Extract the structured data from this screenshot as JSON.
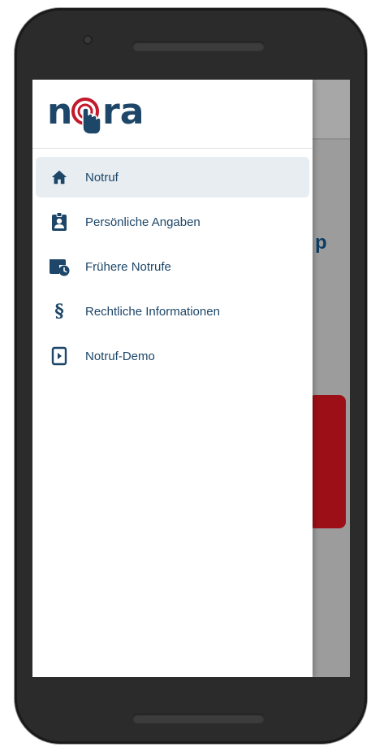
{
  "app": {
    "logo_text": "nora",
    "colors": {
      "brand_blue": "#1d4668",
      "accent_red": "#c4182b",
      "active_bg": "#e7edf1"
    }
  },
  "menu": {
    "items": [
      {
        "label": "Notruf",
        "icon": "home-icon",
        "active": true
      },
      {
        "label": "Persönliche Angaben",
        "icon": "id-badge-icon",
        "active": false
      },
      {
        "label": "Frühere Notrufe",
        "icon": "call-history-icon",
        "active": false
      },
      {
        "label": "Rechtliche Informationen",
        "icon": "paragraph-icon",
        "active": false
      },
      {
        "label": "Notruf-Demo",
        "icon": "play-icon",
        "active": false
      }
    ]
  },
  "background": {
    "partial_text": "p"
  }
}
